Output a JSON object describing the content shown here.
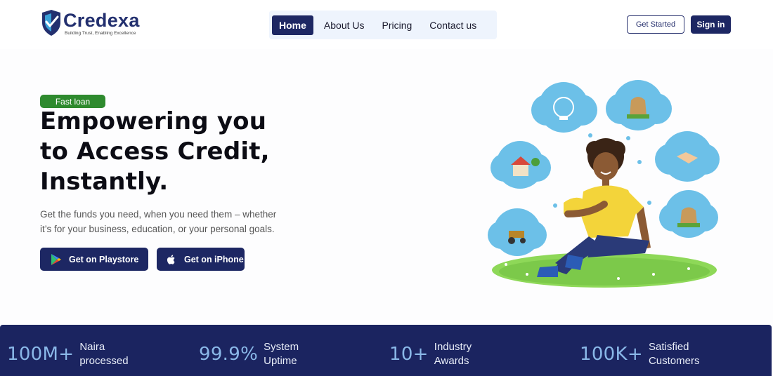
{
  "brand": {
    "name": "Credexa",
    "tagline": "Building Trust, Enabling Excellence"
  },
  "nav": {
    "items": [
      {
        "label": "Home",
        "active": true
      },
      {
        "label": "About Us",
        "active": false
      },
      {
        "label": "Pricing",
        "active": false
      },
      {
        "label": "Contact us",
        "active": false
      }
    ]
  },
  "header_actions": {
    "get_started": "Get Started",
    "sign_in": "Sign in"
  },
  "hero": {
    "badge": "Fast loan",
    "headline_lines": [
      "Empowering you",
      "to Access Credit,",
      "Instantly."
    ],
    "subtext_lines": [
      "Get the funds you need, when you need them – whether",
      "it’s for your business, education, or your personal goals."
    ],
    "playstore_label": "Get on Playstore",
    "iphone_label": "Get on iPhone"
  },
  "stats": [
    {
      "value": "100M+",
      "label_line1": "Naira",
      "label_line2": "processed"
    },
    {
      "value": "99.9%",
      "label_line1": "System",
      "label_line2": "Uptime"
    },
    {
      "value": "10+",
      "label_line1": "Industry",
      "label_line2": "Awards"
    },
    {
      "value": "100K+",
      "label_line1": "Satisfied",
      "label_line2": "Customers"
    }
  ],
  "colors": {
    "primary": "#1d2763",
    "badge_green": "#2e8a2e",
    "nav_bg": "#eef4fd",
    "stat_number": "#8ab8e8"
  },
  "icons": {
    "logo": "shield-check-icon",
    "playstore": "google-play-icon",
    "apple": "apple-icon"
  }
}
